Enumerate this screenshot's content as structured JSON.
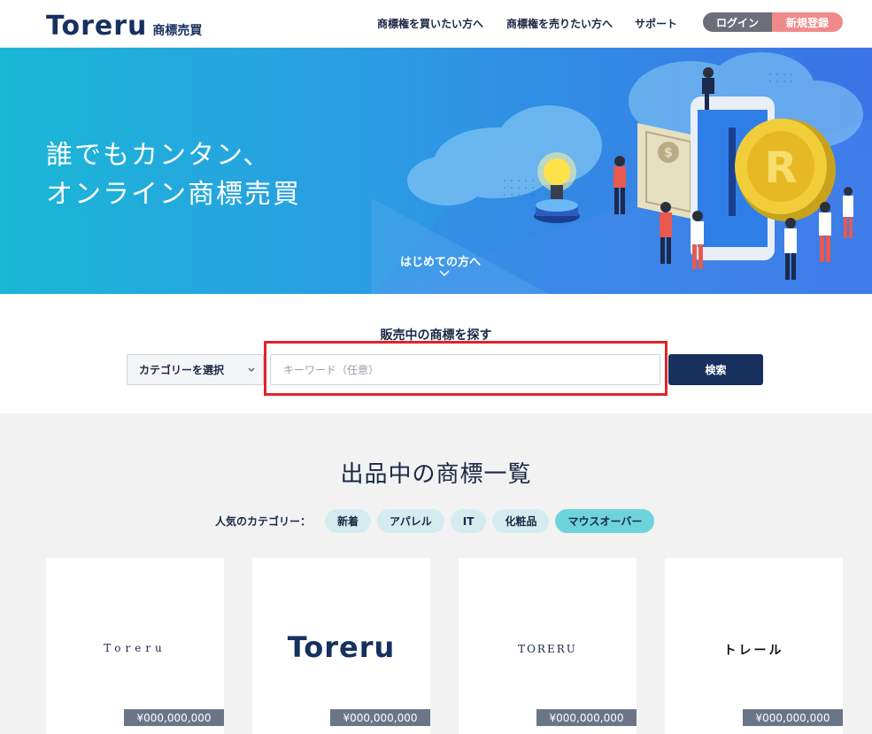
{
  "header": {
    "logo_word": "Toreru",
    "logo_sub": "商標売買",
    "nav": [
      "商標権を買いたい方へ",
      "商標権を売りたい方へ",
      "サポート"
    ],
    "login_label": "ログイン",
    "signup_label": "新規登録"
  },
  "hero": {
    "title_line1": "誰でもカンタン、",
    "title_line2": "オンライン商標売買",
    "first_link": "はじめての方へ",
    "coin_letter": "R",
    "bill_symbol": "$"
  },
  "search": {
    "title": "販売中の商標を探す",
    "category_label": "カテゴリーを選択",
    "keyword_placeholder": "キーワード（任意）",
    "submit_label": "検索"
  },
  "listing": {
    "title": "出品中の商標一覧",
    "popular_label": "人気のカテゴリー：",
    "chips": [
      "新着",
      "アパレル",
      "IT",
      "化粧品",
      "マウスオーバー"
    ],
    "cards": [
      {
        "name": "Toreru",
        "price": "¥000,000,000"
      },
      {
        "name": "Toreru",
        "price": "¥000,000,000"
      },
      {
        "name": "TORERU",
        "price": "¥000,000,000"
      },
      {
        "name": "トレール",
        "price": "¥000,000,000"
      }
    ]
  },
  "colors": {
    "navy": "#17305e",
    "signup": "#f08a8a",
    "login": "#6c6f77",
    "chip": "#d4ecef",
    "chip_active": "#6fd3dc",
    "highlight": "#e0232b"
  }
}
